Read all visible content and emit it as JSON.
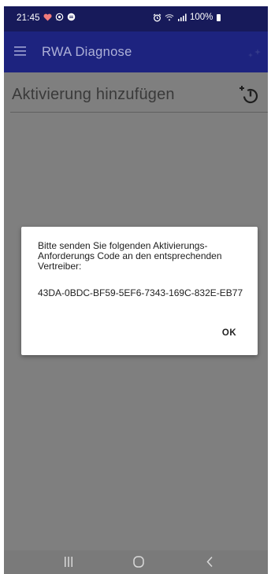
{
  "status_bar": {
    "time": "21:45",
    "battery": "100%",
    "left_icons": [
      "heart-icon",
      "whatsapp-icon",
      "message-icon"
    ],
    "right_icons": [
      "alarm-icon",
      "wifi-icon",
      "signal-icon",
      "battery-icon"
    ]
  },
  "app_bar": {
    "title": "RWA Diagnose",
    "menu_icon": "hamburger-menu-icon",
    "action_icon": "sparkle-icon"
  },
  "section": {
    "title": "Aktivierung hinzufügen",
    "action_icon": "add-activation-icon"
  },
  "dialog": {
    "message": "Bitte senden Sie folgenden Aktivierungs-Anforderungs Code an den entsprechenden Vertreiber:",
    "code": "43DA-0BDC-BF59-5EF6-7343-169C-832E-EB77",
    "ok_label": "OK"
  },
  "nav_bar": {
    "recent_icon": "recent-apps-icon",
    "home_icon": "home-icon",
    "back_icon": "back-icon"
  },
  "colors": {
    "status_bar": "#171a5a",
    "app_bar": "#1d237f",
    "scrim": "#7f7f7f",
    "nav_bar": "#7a7a7a",
    "dialog": "#ffffff"
  }
}
